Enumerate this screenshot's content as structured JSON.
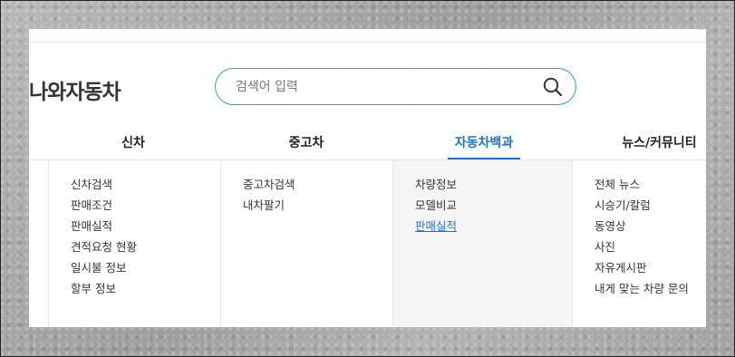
{
  "brand": {
    "text": "나와자동차"
  },
  "search": {
    "placeholder": "검색어 입력",
    "icon": "search-icon"
  },
  "tabs": [
    {
      "label": "신차",
      "active": false
    },
    {
      "label": "중고차",
      "active": false
    },
    {
      "label": "자동차백과",
      "active": true
    },
    {
      "label": "뉴스/커뮤니티",
      "active": false
    }
  ],
  "menus": {
    "new_car": [
      "신차검색",
      "판매조건",
      "판매실적",
      "견적요청 현황",
      "일시불 정보",
      "할부 정보"
    ],
    "used_car": [
      "중고차검색",
      "내차팔기"
    ],
    "encyclopedia": [
      "차량정보",
      "모델비교",
      "판매실적"
    ],
    "news": [
      "전체 뉴스",
      "시승기/칼럼",
      "동영상",
      "사진",
      "자유게시판",
      "내게 맞는 차량 문의"
    ]
  },
  "colors": {
    "accent": "#1e74d3",
    "search_gradient_start": "#35b65a",
    "search_gradient_end": "#2f9bd8"
  }
}
